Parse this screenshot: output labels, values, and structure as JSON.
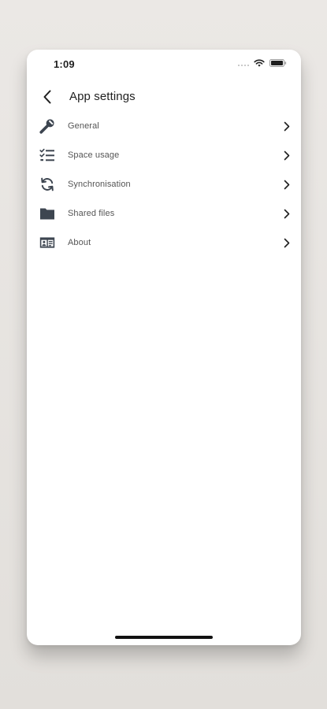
{
  "status_bar": {
    "time": "1:09"
  },
  "header": {
    "title": "App settings"
  },
  "menu": {
    "items": [
      {
        "label": "General",
        "icon": "wrench-icon"
      },
      {
        "label": "Space usage",
        "icon": "checklist-icon"
      },
      {
        "label": "Synchronisation",
        "icon": "sync-icon"
      },
      {
        "label": "Shared files",
        "icon": "folder-icon"
      },
      {
        "label": "About",
        "icon": "id-card-icon"
      }
    ]
  },
  "colors": {
    "background": "#e7e4e1",
    "card": "#ffffff",
    "icon": "#3d4550",
    "text": "#555555",
    "title": "#1f1f1f"
  }
}
